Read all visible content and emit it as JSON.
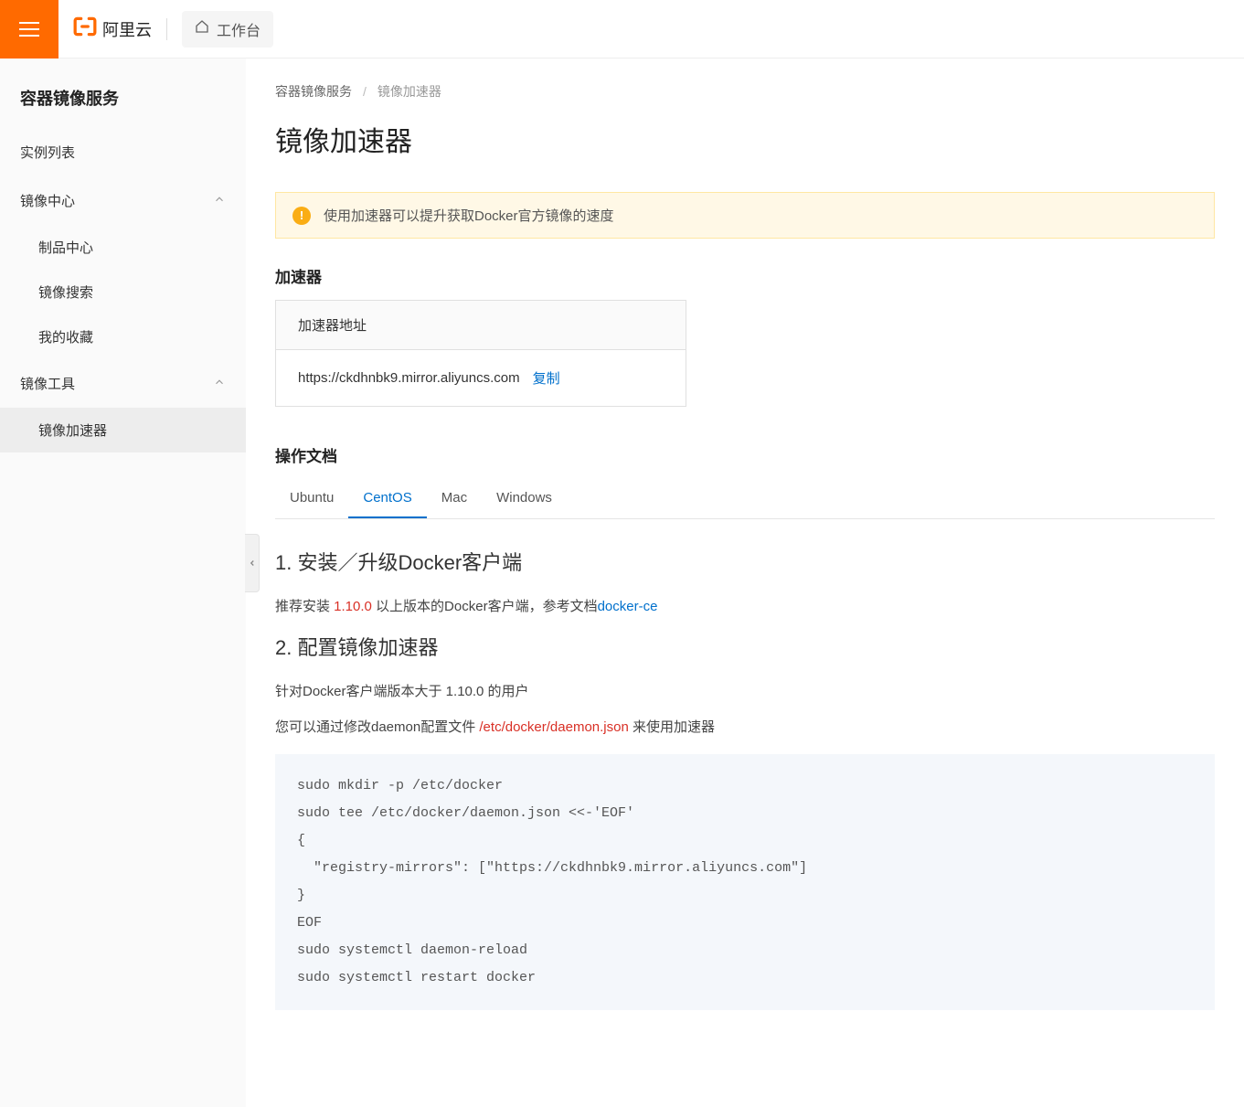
{
  "topbar": {
    "logo_text": "阿里云",
    "workbench": "工作台"
  },
  "sidebar": {
    "title": "容器镜像服务",
    "item_instances": "实例列表",
    "group_mirror_center": "镜像中心",
    "sub_products": "制品中心",
    "sub_search": "镜像搜索",
    "sub_favorites": "我的收藏",
    "group_mirror_tools": "镜像工具",
    "sub_accelerator": "镜像加速器"
  },
  "breadcrumb": {
    "root": "容器镜像服务",
    "current": "镜像加速器"
  },
  "page_title": "镜像加速器",
  "banner": "使用加速器可以提升获取Docker官方镜像的速度",
  "accel": {
    "section": "加速器",
    "header": "加速器地址",
    "url": "https://ckdhnbk9.mirror.aliyuncs.com",
    "copy": "复制"
  },
  "docs": {
    "section": "操作文档",
    "tabs": [
      "Ubuntu",
      "CentOS",
      "Mac",
      "Windows"
    ],
    "h1": "1. 安装／升级Docker客户端",
    "p1_a": "推荐安装 ",
    "p1_ver": "1.10.0",
    "p1_b": " 以上版本的Docker客户端，参考文档",
    "p1_link": "docker-ce",
    "h2": "2. 配置镜像加速器",
    "p2": "针对Docker客户端版本大于 1.10.0 的用户",
    "p3_a": "您可以通过修改daemon配置文件 ",
    "p3_path": "/etc/docker/daemon.json",
    "p3_b": " 来使用加速器",
    "code": "sudo mkdir -p /etc/docker\nsudo tee /etc/docker/daemon.json <<-'EOF'\n{\n  \"registry-mirrors\": [\"https://ckdhnbk9.mirror.aliyuncs.com\"]\n}\nEOF\nsudo systemctl daemon-reload\nsudo systemctl restart docker"
  }
}
